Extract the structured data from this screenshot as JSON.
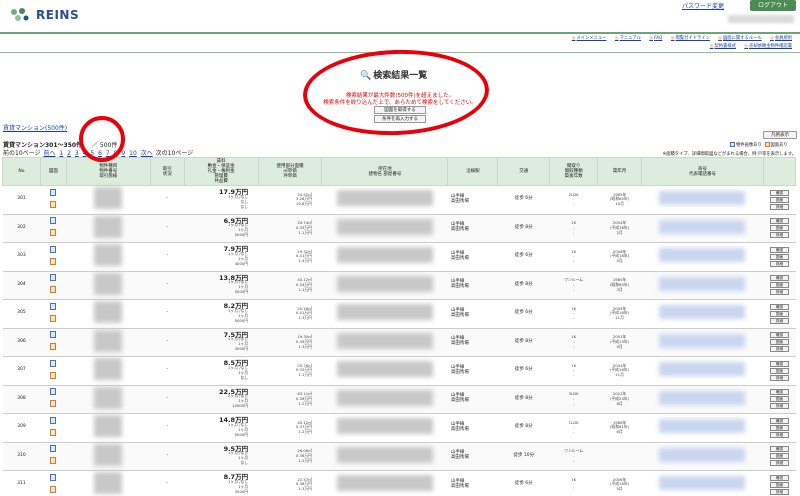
{
  "header": {
    "logo_text": "REINS",
    "password_link": "パスワード変更",
    "logout_label": "ログアウト"
  },
  "nav": {
    "row1": [
      "メインメニュー",
      "マニュアル",
      "FAQ",
      "閲覧ガイドライン",
      "図面に関するルール",
      "会員規則"
    ],
    "row2": [
      "契約書様式",
      "売却依頼主物件確認書"
    ]
  },
  "page": {
    "title": "検索結果一覧",
    "error_line1": "検索結果が最大件数(500件)を超えました。",
    "error_line2": "検索条件を絞り込んだ上で、あらためて検索をしてください。",
    "btn_list": "図面を取得する",
    "btn_research": "条件を再入力する"
  },
  "results": {
    "category": "賃貸マンション(500件)",
    "range": "賃貸マンション301～350件",
    "total": "／ 500件",
    "pager_prev": "前の10ページ",
    "pager_back": "前へ",
    "pager_pages": [
      "1",
      "2",
      "3",
      "4",
      "5",
      "6",
      "7",
      "8",
      "9",
      "10"
    ],
    "pager_next": "次へ",
    "pager_next10": "次の10ページ"
  },
  "legend": {
    "button": "凡例表示",
    "item1": "物件画像あり",
    "item2": "図面あり",
    "note": "※面積タイプ、詳細間取図などがまれる場合、例:戸等を表示します。"
  },
  "colors": {
    "brand_green": "#4d8a55",
    "header_bg": "#dcecdd",
    "annotation_red": "#e8000a",
    "error_red": "#e00000",
    "link_blue": "#1a3fa8"
  },
  "table": {
    "headers": {
      "no": "No",
      "image": "図面",
      "bukken": "物件種目\n物件番号\n取引態様",
      "torihiki": "取引\n状況",
      "price": "賃料\n敷金・保証金\n礼金・権利金\n管理費\n共益費",
      "area": "使用部分面積\n㎡単価\n坪単価",
      "address": "所在地\n建物名 部屋番号",
      "line": "沿線駅",
      "access": "交通",
      "madori": "間取り\n間取種類\n築後年数",
      "built": "築年月",
      "agent": "商号\n代表電話番号",
      "actions": ""
    },
    "action_labels": [
      "確認",
      "図面",
      "詳細"
    ],
    "rows": [
      {
        "no": "301",
        "price": "17.9万円",
        "deposit": "1ヶ月 /なし",
        "reikin": "なし",
        "fee": "なし",
        "area": "54.52㎡",
        "unit": "3.28万円",
        "tsubo": "10.8万円",
        "line": "山手線",
        "station": "高田馬場",
        "access": "徒歩  6分",
        "madori": "2LDK",
        "built": "1985年",
        "built2": "(昭和60年)",
        "month": "10月"
      },
      {
        "no": "302",
        "price": "6.9万円",
        "deposit": "1ヶ月 /なし",
        "reikin": "1ヶ月",
        "fee": "5000円",
        "area": "20.74㎡",
        "unit": "0.33万円",
        "tsubo": "1.1万円",
        "line": "山手線",
        "station": "高田馬場",
        "access": "徒歩  8分",
        "madori": "1K",
        "built": "2004年",
        "built2": "(平成16年)",
        "month": "2月"
      },
      {
        "no": "303",
        "price": "7.9万円",
        "deposit": "1ヶ月 /なし",
        "reikin": "1ヶ月",
        "fee": "4000円",
        "area": "19.32㎡",
        "unit": "0.41万円",
        "tsubo": "1.4万円",
        "line": "山手線",
        "station": "高田馬場",
        "access": "徒歩  6分",
        "madori": "1K",
        "built": "2006年",
        "built2": "(平成18年)",
        "month": "4月"
      },
      {
        "no": "304",
        "price": "13.8万円",
        "deposit": "1ヶ月 /なし",
        "reikin": "1ヶ月",
        "fee": "5000円",
        "area": "40.12㎡",
        "unit": "0.34万円",
        "tsubo": "1.1万円",
        "line": "山手線",
        "station": "高田馬場",
        "access": "徒歩  8分",
        "madori": "ワンルーム",
        "built": "1985年",
        "built2": "(昭和60年)",
        "month": "3月"
      },
      {
        "no": "305",
        "price": "8.2万円",
        "deposit": "1ヶ月 /なし",
        "reikin": "1ヶ月",
        "fee": "5000円",
        "area": "20.16㎡",
        "unit": "0.41万円",
        "tsubo": "1.3万円",
        "line": "山手線",
        "station": "高田馬場",
        "access": "徒歩  6分",
        "madori": "1K",
        "built": "2004年",
        "built2": "(平成16年)",
        "month": "11月"
      },
      {
        "no": "306",
        "price": "7.5万円",
        "deposit": "1ヶ月 /なし",
        "reikin": "1ヶ月",
        "fee": "3000円",
        "area": "19.30㎡",
        "unit": "0.39万円",
        "tsubo": "1.3万円",
        "line": "山手線",
        "station": "高田馬場",
        "access": "徒歩  8分",
        "madori": "1K",
        "built": "2001年",
        "built2": "(平成13年)",
        "month": "9月"
      },
      {
        "no": "307",
        "price": "8.5万円",
        "deposit": "1ヶ月 /なし",
        "reikin": "1ヶ月",
        "fee": "なし",
        "area": "25.76㎡",
        "unit": "0.33万円",
        "tsubo": "1.1万円",
        "line": "山手線",
        "station": "高田馬場",
        "access": "徒歩  6分",
        "madori": "1K",
        "built": "2004年",
        "built2": "(平成16年)",
        "month": "11月"
      },
      {
        "no": "308",
        "price": "22.5万円",
        "deposit": "2ヶ月 /なし",
        "reikin": "1ヶ月",
        "fee": "10000円",
        "area": "63.11㎡",
        "unit": "0.36万円",
        "tsubo": "1.2万円",
        "line": "山手線",
        "station": "高田馬場",
        "access": "徒歩  8分",
        "madori": "3LDK",
        "built": "2012年",
        "built2": "(平成24年)",
        "month": "8月"
      },
      {
        "no": "309",
        "price": "14.8万円",
        "deposit": "1ヶ月 /なし",
        "reikin": "1ヶ月",
        "fee": "5000円",
        "area": "40.12㎡",
        "unit": "0.37万円",
        "tsubo": "1.2万円",
        "line": "山手線",
        "station": "高田馬場",
        "access": "徒歩  8分",
        "madori": "1LDK",
        "built": "1986年",
        "built2": "(昭和61年)",
        "month": "6月"
      },
      {
        "no": "310",
        "price": "9.5万円",
        "deposit": "1ヶ月 /なし",
        "reikin": "1ヶ月",
        "fee": "なし",
        "area": "26.06㎡",
        "unit": "0.36万円",
        "tsubo": "1.2万円",
        "line": "山手線",
        "station": "高田馬場",
        "access": "徒歩 10分",
        "madori": "ワンルーム",
        "built": "",
        "built2": "",
        "month": ""
      },
      {
        "no": "311",
        "price": "8.7万円",
        "deposit": "1ヶ月 /なし",
        "reikin": "1ヶ月",
        "fee": "3000円",
        "area": "22.57㎡",
        "unit": "0.38万円",
        "tsubo": "1.3万円",
        "line": "山手線",
        "station": "高田馬場",
        "access": "徒歩  6分",
        "madori": "1K",
        "built": "2006年",
        "built2": "(平成18年)",
        "month": "5月"
      }
    ]
  }
}
